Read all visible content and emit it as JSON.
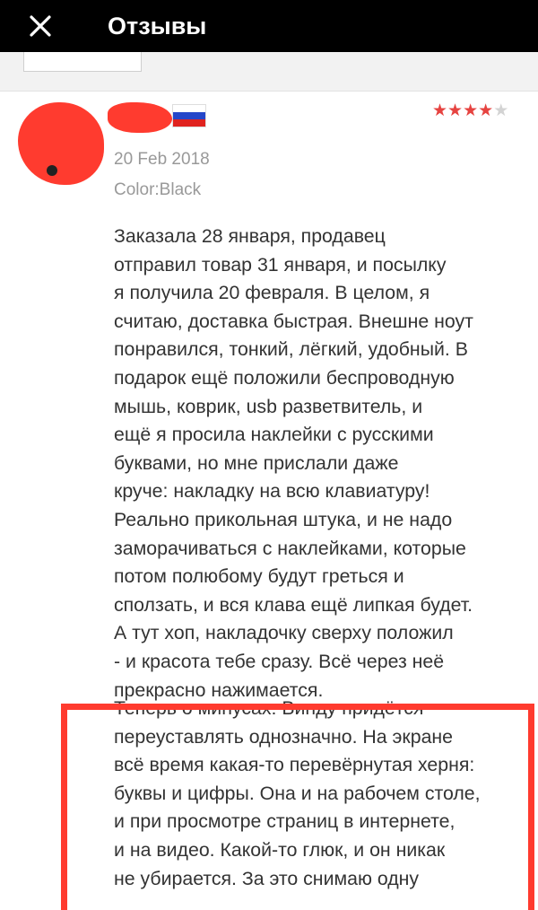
{
  "header": {
    "title": "Отзывы",
    "close_icon": "close-icon"
  },
  "review": {
    "rating": 4,
    "rating_max": 5,
    "star_on_color": "#e64340",
    "star_off_color": "#d3d3d3",
    "flag_icon": "russia-flag-icon",
    "date": "20 Feb 2018",
    "color_label": "Color:Black",
    "text_part1": "Заказала 28 января, продавец\nотправил товар 31 января, и посылку\nя получила 20 февраля. В целом, я\nсчитаю, доставка быстрая. Внешне ноут\nпонравился, тонкий, лёгкий, удобный. В\nподарок ещё положили беспроводную\nмышь, коврик, usb разветвитель, и\nещё я просила наклейки с русскими\nбуквами, но мне прислали даже\nкруче: накладку на всю клавиатуру!\nРеально прикольная штука, и не надо\nзаморачиваться с наклейками, которые\nпотом полюбому будут греться и\nсползать, и вся клава ещё липкая будет.\nА тут хоп, накладочку сверху положил\n- и красота тебе сразу. Всё через неё\nпрекрасно нажимается.",
    "text_part2": "Теперь о минусах: Винду придётся\nпереуставлять однозначно. На экране\nвсё время какая-то перевёрнутая херня:\nбуквы и цифры. Она и на рабочем столе,\nи при просмотре страниц в интернете,\nи на видео. Какой-то глюк, и он никак\nне убирается. За это снимаю одну"
  },
  "highlight_color": "#ff3b2f"
}
